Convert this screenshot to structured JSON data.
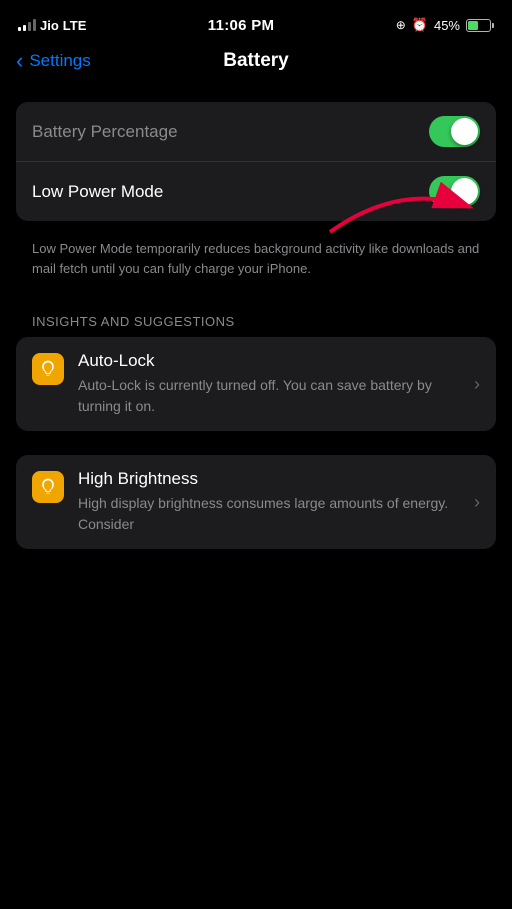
{
  "statusBar": {
    "carrier": "Jio",
    "networkType": "LTE",
    "time": "11:06 PM",
    "batteryPercent": "45%"
  },
  "navBar": {
    "backLabel": "Settings",
    "title": "Battery"
  },
  "settings": {
    "batteryPercentage": {
      "label": "Battery Percentage",
      "isOn": true
    },
    "lowPowerMode": {
      "label": "Low Power Mode",
      "isOn": true,
      "description": "Low Power Mode temporarily reduces background activity like downloads and mail fetch until you can fully charge your iPhone."
    }
  },
  "insightsSection": {
    "header": "INSIGHTS AND SUGGESTIONS",
    "items": [
      {
        "title": "Auto-Lock",
        "description": "Auto-Lock is currently turned off. You can save battery by turning it on."
      },
      {
        "title": "High Brightness",
        "description": "High display brightness consumes large amounts of energy. Consider"
      }
    ]
  }
}
